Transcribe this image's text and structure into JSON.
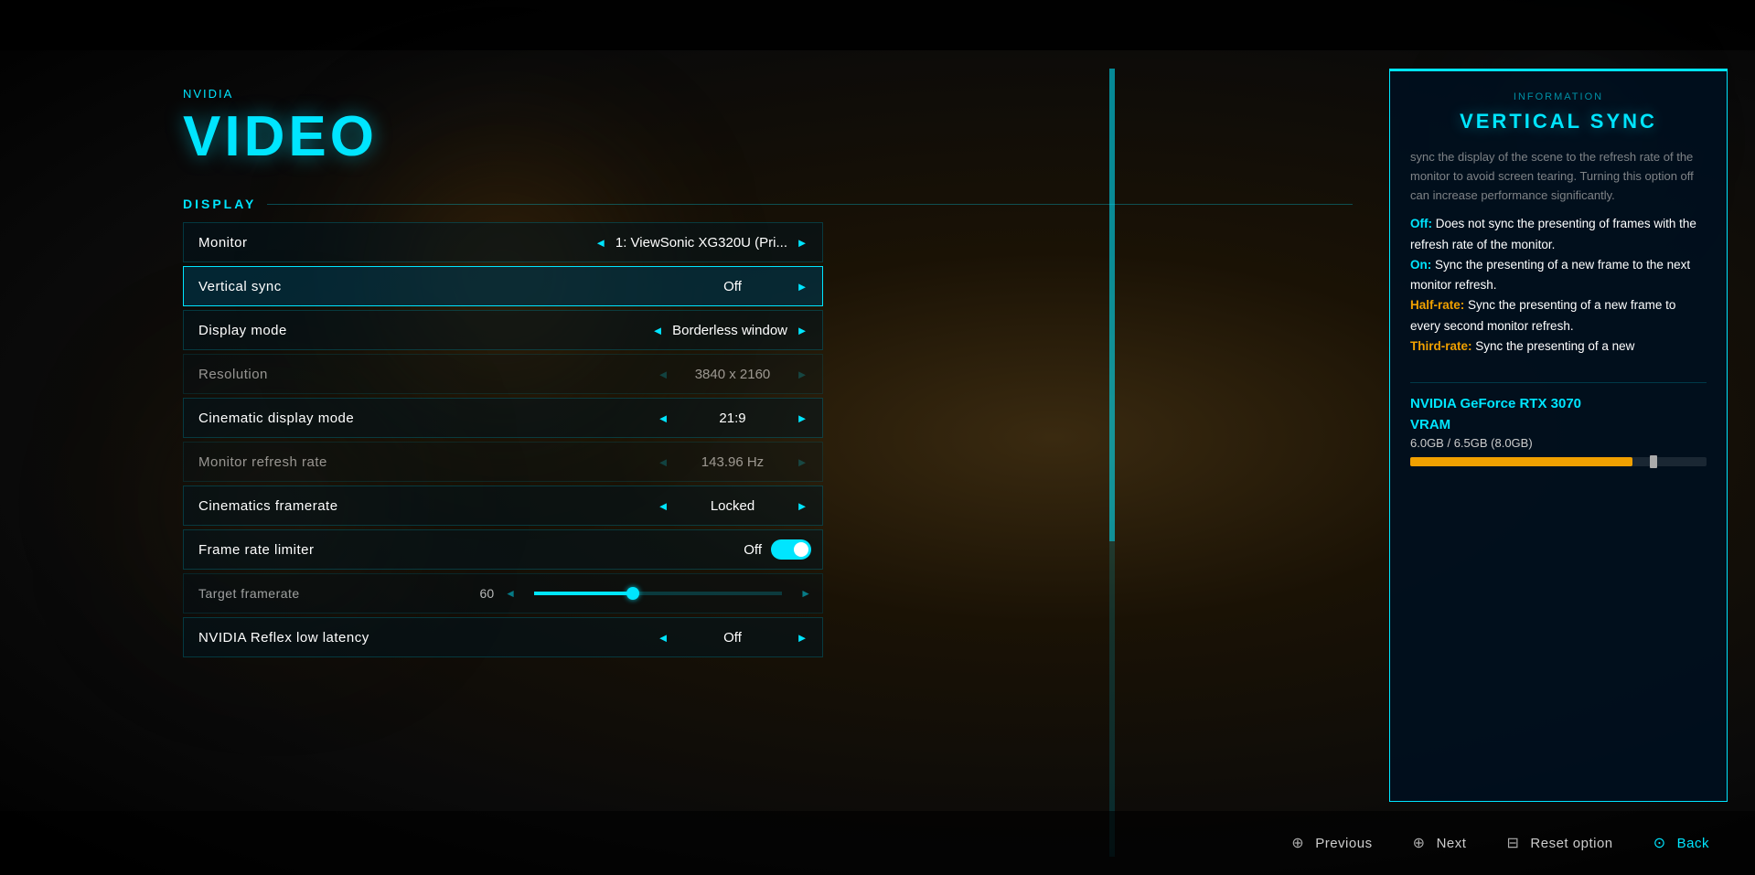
{
  "meta_label": "NVIDIA",
  "page_title": "VIDEO",
  "section_display": "DISPLAY",
  "settings": [
    {
      "id": "monitor",
      "label": "Monitor",
      "value": "1: ViewSonic XG320U (Pri...",
      "arrow_left": "◄",
      "arrow_right": "►",
      "active": false,
      "dimmed": false,
      "has_toggle": false
    },
    {
      "id": "vertical_sync",
      "label": "Vertical sync",
      "value": "Off",
      "arrow_left": "",
      "arrow_right": "►",
      "active": true,
      "dimmed": false,
      "has_toggle": false
    },
    {
      "id": "display_mode",
      "label": "Display mode",
      "value": "Borderless window",
      "arrow_left": "◄",
      "arrow_right": "►",
      "active": false,
      "dimmed": false,
      "has_toggle": false
    },
    {
      "id": "resolution",
      "label": "Resolution",
      "value": "3840 x 2160",
      "arrow_left": "◄",
      "arrow_right": "►",
      "active": false,
      "dimmed": true,
      "has_toggle": false
    },
    {
      "id": "cinematic_display_mode",
      "label": "Cinematic display mode",
      "value": "21:9",
      "arrow_left": "◄",
      "arrow_right": "►",
      "active": false,
      "dimmed": false,
      "has_toggle": false
    },
    {
      "id": "monitor_refresh_rate",
      "label": "Monitor refresh rate",
      "value": "143.96 Hz",
      "arrow_left": "◄",
      "arrow_right": "►",
      "active": false,
      "dimmed": true,
      "has_toggle": false
    },
    {
      "id": "cinematics_framerate",
      "label": "Cinematics framerate",
      "value": "Locked",
      "arrow_left": "◄",
      "arrow_right": "►",
      "active": false,
      "dimmed": false,
      "has_toggle": false
    },
    {
      "id": "frame_rate_limiter",
      "label": "Frame rate limiter",
      "value": "Off",
      "arrow_left": "",
      "arrow_right": "",
      "active": false,
      "dimmed": false,
      "has_toggle": true
    },
    {
      "id": "nvidia_reflex",
      "label": "NVIDIA Reflex low latency",
      "value": "Off",
      "arrow_left": "◄",
      "arrow_right": "►",
      "active": false,
      "dimmed": false,
      "has_toggle": false
    }
  ],
  "slider": {
    "label": "Target framerate",
    "value": "60",
    "fill_percent": 40
  },
  "tooltip": {
    "section_label": "INFORMATION",
    "title": "VERTICAL SYNC",
    "cut_text": "sync the display of the scene to the refresh rate of the monitor to avoid screen tearing. Turning this option off can increase performance significantly.",
    "off_text": "Off: Does not sync the presenting of frames with the refresh rate of the monitor.",
    "on_text": "On: Sync the presenting of a new frame to the next monitor refresh.",
    "halfrate_text": "Half-rate: Sync the presenting of a new frame to every second monitor refresh.",
    "thirdrate_text": "Third-rate: Sync the presenting of a new"
  },
  "gpu": {
    "name": "NVIDIA GeForce RTX 3070",
    "vram_label": "VRAM",
    "vram_value": "6.0GB / 6.5GB (8.0GB)",
    "vram_fill_percent": 75
  },
  "nav": {
    "previous_label": "Previous",
    "next_label": "Next",
    "reset_label": "Reset option",
    "back_label": "Back"
  }
}
